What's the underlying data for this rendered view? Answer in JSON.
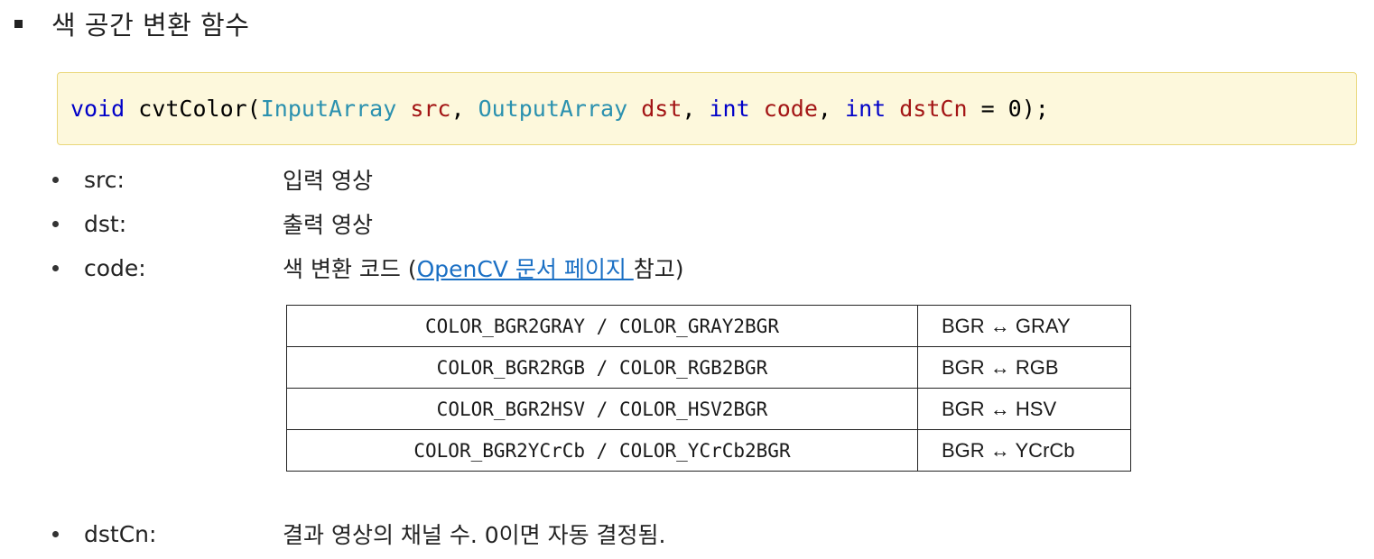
{
  "heading": "색 공간 변환 함수",
  "signature": {
    "t1": "void",
    "t2": " cvtColor(",
    "t3": "InputArray",
    "t4": " ",
    "t5": "src",
    "t6": ", ",
    "t7": "OutputArray",
    "t8": " ",
    "t9": "dst",
    "t10": ", ",
    "t11": "int",
    "t12": " ",
    "t13": "code",
    "t14": ", ",
    "t15": "int",
    "t16": " ",
    "t17": "dstCn",
    "t18": " = 0);"
  },
  "params": {
    "src": {
      "name": "src:",
      "desc": "입력 영상"
    },
    "dst": {
      "name": "dst:",
      "desc": "출력 영상"
    },
    "code": {
      "name": "code:",
      "desc_pre": "색 변환 코드 (",
      "link": "OpenCV 문서 페이지 ",
      "desc_post": "참고)"
    },
    "dstCn": {
      "name": "dstCn:",
      "desc": "결과 영상의 채널 수. 0이면 자동 결정됨."
    }
  },
  "table": [
    {
      "codes": "COLOR_BGR2GRAY  /  COLOR_GRAY2BGR",
      "desc": "BGR ↔ GRAY"
    },
    {
      "codes": "COLOR_BGR2RGB  /  COLOR_RGB2BGR",
      "desc": "BGR ↔ RGB"
    },
    {
      "codes": "COLOR_BGR2HSV  /  COLOR_HSV2BGR",
      "desc": "BGR ↔ HSV"
    },
    {
      "codes": "COLOR_BGR2YCrCb  /  COLOR_YCrCb2BGR",
      "desc": "BGR ↔ YCrCb"
    }
  ]
}
